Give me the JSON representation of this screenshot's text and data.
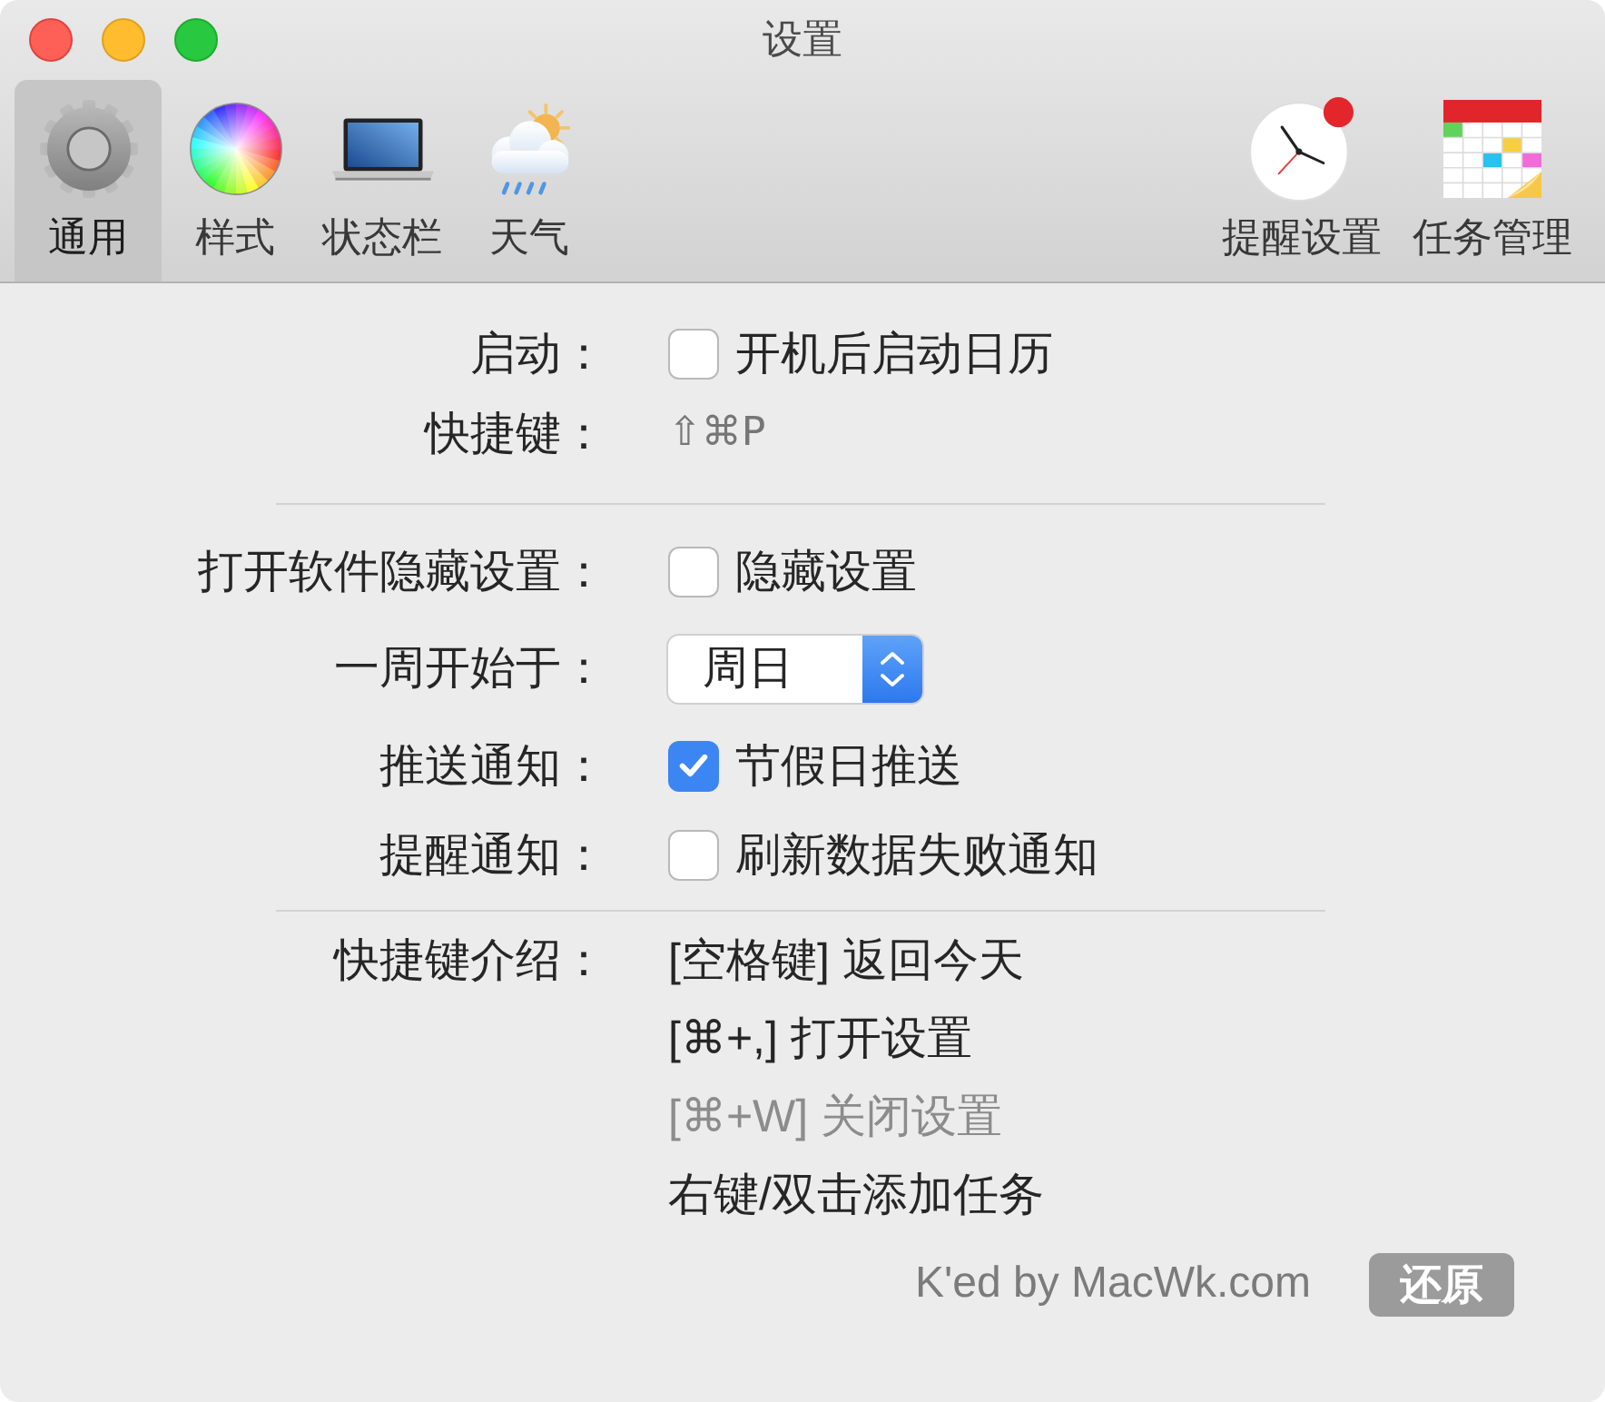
{
  "window": {
    "title": "设置"
  },
  "toolbar": {
    "tabs": [
      {
        "label": "通用",
        "selected": true
      },
      {
        "label": "样式",
        "selected": false
      },
      {
        "label": "状态栏",
        "selected": false
      },
      {
        "label": "天气",
        "selected": false
      }
    ],
    "actions": [
      {
        "label": "提醒设置"
      },
      {
        "label": "任务管理"
      }
    ]
  },
  "settings": {
    "sections": [
      {
        "rows": [
          {
            "kind": "checkbox",
            "label": "启动：",
            "text": "开机后启动日历",
            "checked": false
          },
          {
            "kind": "shortcut",
            "label": "快捷键：",
            "text": "⇧⌘P"
          }
        ]
      },
      {
        "rows": [
          {
            "kind": "checkbox",
            "label": "打开软件隐藏设置：",
            "text": "隐藏设置",
            "checked": false
          },
          {
            "kind": "popup",
            "label": "一周开始于：",
            "value": "周日"
          },
          {
            "kind": "checkbox",
            "label": "推送通知：",
            "text": "节假日推送",
            "checked": true
          },
          {
            "kind": "checkbox",
            "label": "提醒通知：",
            "text": "刷新数据失败通知",
            "checked": false
          }
        ]
      },
      {
        "rows": [
          {
            "kind": "list",
            "label": "快捷键介绍：",
            "items": [
              {
                "text": "[空格键] 返回今天",
                "disabled": false
              },
              {
                "text": "[⌘+,] 打开设置",
                "disabled": false
              },
              {
                "text": "[⌘+W] 关闭设置",
                "disabled": true
              },
              {
                "text": "右键/双击添加任务",
                "disabled": false
              }
            ]
          }
        ]
      }
    ]
  },
  "footer": {
    "credit": "K'ed by MacWk.com",
    "button": "还原"
  }
}
